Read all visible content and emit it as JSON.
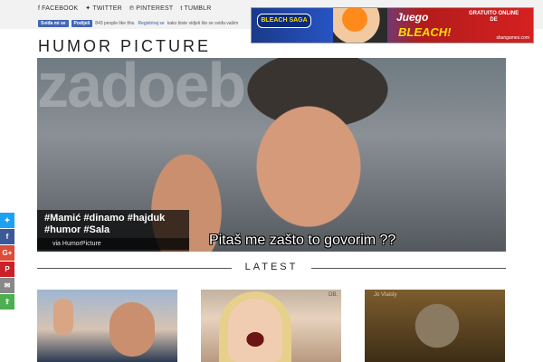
{
  "social": {
    "items": [
      {
        "icon": "facebook-icon",
        "glyph": "f",
        "label": "FACEBOOK"
      },
      {
        "icon": "twitter-icon",
        "glyph": "✦",
        "label": "TWITTER"
      },
      {
        "icon": "pinterest-icon",
        "glyph": "℗",
        "label": "PINTEREST"
      },
      {
        "icon": "tumblr-icon",
        "glyph": "t",
        "label": "TUMBLR"
      }
    ]
  },
  "fb_widget": {
    "like_label": "Sviđa mi se",
    "share_label": "Podijeli",
    "count_text": "843 people like this.",
    "register_link": "Registriraj se",
    "tail_text": "kako biste vidjeli što se sviđa vašim"
  },
  "ad": {
    "logo": "BLEACH SAGA",
    "line1": "Juego",
    "line2a": "GRATUITO ONLINE",
    "line2b": "DE",
    "line3": "BLEACH!",
    "footer": "sbangames.com"
  },
  "site_title": "HUMOR PICTURE",
  "hero": {
    "bg_text": "zadoeb",
    "tags": "#Mamić #dinamo #hajduk #humor #Sala",
    "via": "via HumorPicture",
    "overlay_text": "Pitaš me zašto to govorim ??"
  },
  "latest_label": "LATEST",
  "cards": [
    {
      "tag": ""
    },
    {
      "tag": "DB."
    },
    {
      "tag": "Jo Vlaisly"
    }
  ],
  "share_buttons": [
    {
      "name": "twitter-share-button",
      "glyph": "✦"
    },
    {
      "name": "facebook-share-button",
      "glyph": "f"
    },
    {
      "name": "googleplus-share-button",
      "glyph": "G+"
    },
    {
      "name": "pinterest-share-button",
      "glyph": "P"
    },
    {
      "name": "email-share-button",
      "glyph": "✉"
    },
    {
      "name": "more-share-button",
      "glyph": "⇪"
    }
  ]
}
